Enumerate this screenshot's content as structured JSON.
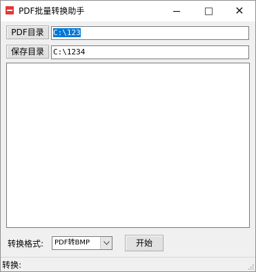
{
  "window": {
    "title": "PDF批量转换助手",
    "controls": {
      "minimize_icon": "minimize-icon",
      "maximize_icon": "maximize-icon",
      "close_glyph": "✕"
    }
  },
  "pdf_dir": {
    "button_label": "PDF目录",
    "path_value": "C:\\123"
  },
  "save_dir": {
    "button_label": "保存目录",
    "path_value": "C:\\1234"
  },
  "log": {
    "content": ""
  },
  "format": {
    "label": "转换格式:",
    "selected": "PDF转BMP"
  },
  "actions": {
    "start_label": "开始"
  },
  "status": {
    "label": "转换:"
  },
  "colors": {
    "selection": "#0078d7",
    "app_icon": "#e53935"
  }
}
